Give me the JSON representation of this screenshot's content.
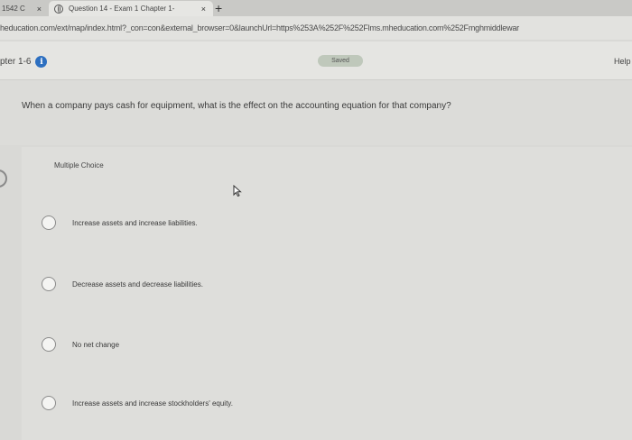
{
  "browser": {
    "prev_tab_label": "1542 C",
    "active_tab_label": "Question 14 - Exam 1 Chapter 1-",
    "close_glyph": "×",
    "new_tab_glyph": "+",
    "url": "heducation.com/ext/map/index.html?_con=con&external_browser=0&launchUrl=https%253A%252F%252Flms.mheducation.com%252Fmghmiddlewar"
  },
  "header": {
    "chapter_label": "pter 1-6",
    "info_glyph": "i",
    "saved_label": "Saved",
    "help_label": "Help"
  },
  "question": {
    "text": "When a company pays cash for equipment, what is the effect on the accounting equation for that company?"
  },
  "answer_panel": {
    "type_label": "Multiple Choice",
    "options": [
      {
        "label": "Increase assets and increase liabilities."
      },
      {
        "label": "Decrease assets and decrease liabilities."
      },
      {
        "label": "No net change"
      },
      {
        "label": "Increase assets and increase stockholders' equity."
      }
    ]
  },
  "icons": {
    "cursor": "pointer-cursor-icon",
    "info": "info-icon",
    "globe": "globe-icon"
  }
}
